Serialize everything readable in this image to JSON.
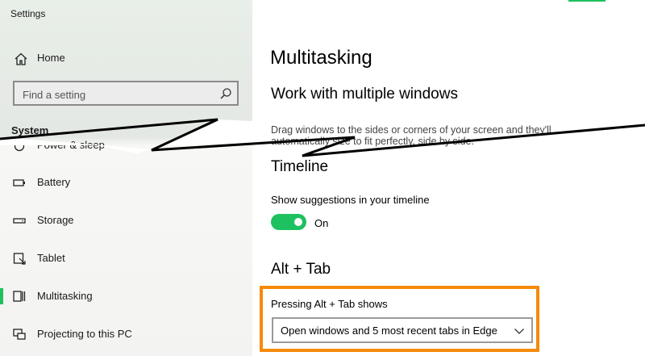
{
  "window": {
    "title": "Settings"
  },
  "sidebar": {
    "home_label": "Home",
    "search_placeholder": "Find a setting",
    "section_label": "System",
    "items": [
      {
        "label": "Power & sleep",
        "icon": "power-icon"
      },
      {
        "label": "Battery",
        "icon": "battery-icon"
      },
      {
        "label": "Storage",
        "icon": "storage-icon"
      },
      {
        "label": "Tablet",
        "icon": "tablet-icon"
      },
      {
        "label": "Multitasking",
        "icon": "multitasking-icon",
        "active": true
      },
      {
        "label": "Projecting to this PC",
        "icon": "projecting-icon"
      }
    ]
  },
  "main": {
    "title": "Multitasking",
    "snap": {
      "heading": "Work with multiple windows",
      "description_line1": "Drag windows to the sides or corners of your screen and they'll",
      "description_line2": "automatically size to fit perfectly, side by side."
    },
    "timeline": {
      "heading": "Timeline",
      "suggestions_label": "Show suggestions in your timeline",
      "toggle_state": "On"
    },
    "alttab": {
      "heading": "Alt + Tab",
      "label": "Pressing Alt + Tab shows",
      "selected": "Open windows and 5 most recent tabs in Edge"
    }
  },
  "colors": {
    "accent": "#1ec15f",
    "highlight": "#f58a0a"
  }
}
